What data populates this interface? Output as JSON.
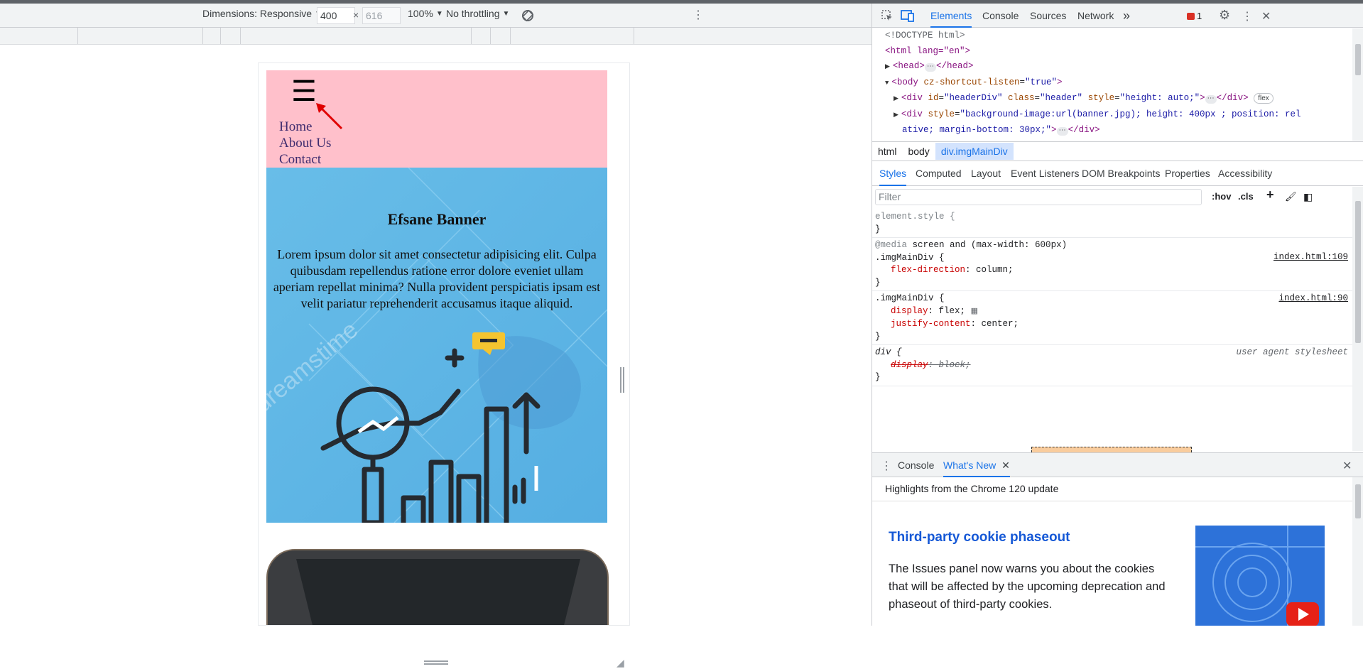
{
  "device_toolbar": {
    "dimensions_label": "Dimensions: Responsive",
    "width": "400",
    "height_placeholder": "616",
    "times": "×",
    "zoom": "100%",
    "throttling": "No throttling",
    "more": "⋮"
  },
  "page": {
    "menu_icon": "☰",
    "nav": [
      "Home",
      "About Us",
      "Contact"
    ],
    "banner_title": "Efsane Banner",
    "banner_text": "Lorem ipsum dolor sit amet consectetur adipisicing elit. Culpa quibusdam repellendus ratione error dolore eveniet ullam aperiam repellat minima? Nulla provident perspiciatis ipsam est velit pariatur reprehenderit accusamus itaque aliquid.",
    "watermark": "dreamstime",
    "colors": {
      "header_bg": "#ffc0cb",
      "banner_bg": "#62b8e8",
      "annotation_arrow": "#e00000"
    }
  },
  "devtools": {
    "tabs": [
      "Elements",
      "Console",
      "Sources",
      "Network"
    ],
    "more_tabs": "»",
    "issues_count": "1",
    "dom": {
      "doctype": "<!DOCTYPE html>",
      "html_open": "<html lang=\"en\">",
      "head": "<head>",
      "head_close": "</head>",
      "body_tag": "<body",
      "body_attr": "cz-shortcut-listen",
      "body_val": "\"true\"",
      "div1_tag": "<div",
      "div1_id": "\"headerDiv\"",
      "div1_class": "\"header\"",
      "div1_style": "\"height: auto;\"",
      "div_close": "</div>",
      "flex_badge": "flex",
      "div2_style_a": "\"background-image:url(banner.jpg); height: 400px ; position: rel",
      "div2_style_b": "ative; margin-bottom: 30px;\""
    },
    "breadcrumbs": [
      "html",
      "body",
      "div.imgMainDiv"
    ],
    "sub_tabs": [
      "Styles",
      "Computed",
      "Layout",
      "Event Listeners",
      "DOM Breakpoints",
      "Properties",
      "Accessibility"
    ],
    "filter_placeholder": "Filter",
    "hov": ":hov",
    "cls": ".cls",
    "styles": {
      "element_style": "element.style {",
      "close": "}",
      "media_kw": "@media",
      "media_query": "screen and (max-width: 600px)",
      "rule1_selector": ".imgMainDiv {",
      "rule1_source": "index.html:109",
      "rule1_prop": "flex-direction",
      "rule1_val": "column;",
      "rule2_selector": ".imgMainDiv {",
      "rule2_source": "index.html:90",
      "rule2_prop1": "display",
      "rule2_val1": "flex;",
      "rule2_prop2": "justify-content",
      "rule2_val2": "center;",
      "rule3_selector": "div {",
      "rule3_source": "user agent stylesheet",
      "rule3_prop": "display",
      "rule3_val": "block;"
    },
    "drawer": {
      "tabs": [
        "Console",
        "What's New"
      ],
      "subtitle": "Highlights from the Chrome 120 update",
      "article_title": "Third-party cookie phaseout",
      "article_body": "The Issues panel now warns you about the cookies that will be affected by the upcoming deprecation and phaseout of third-party cookies."
    }
  }
}
